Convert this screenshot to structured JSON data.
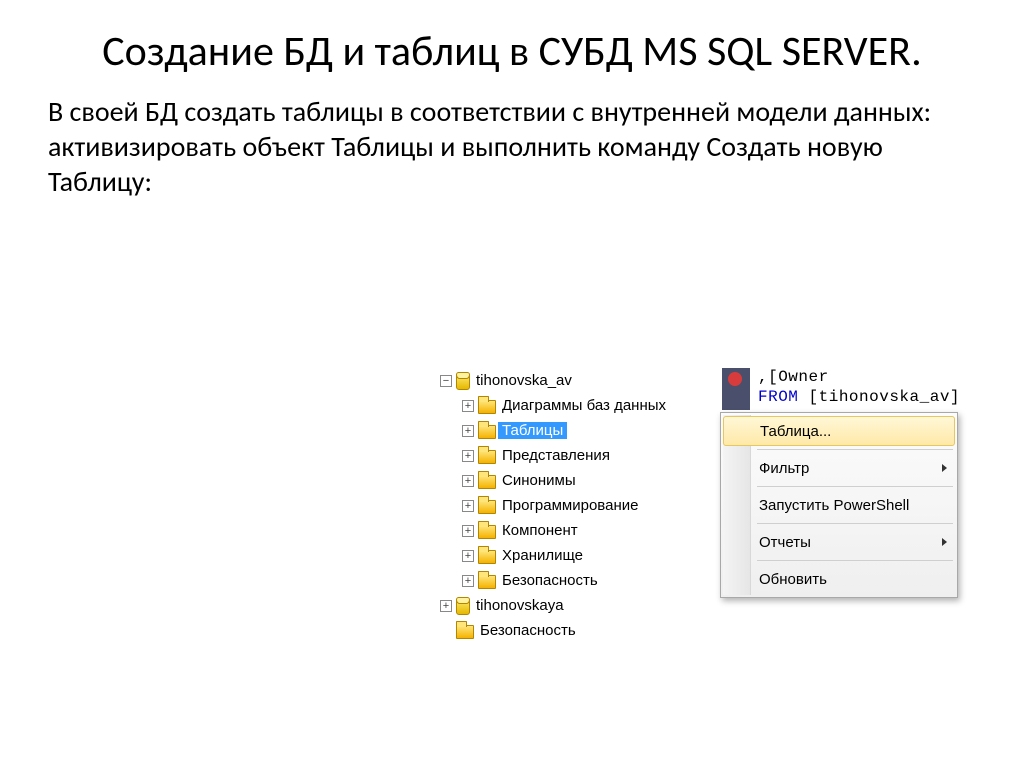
{
  "title": "Создание БД и таблиц в СУБД MS SQL SERVER.",
  "body": "В своей БД создать таблицы в соответствии с внутренней модели данных: активизировать объект Таблицы и выполнить команду Создать новую Таблицу:",
  "tree": {
    "db1": "tihonovska_av",
    "items": [
      "Диаграммы баз данных",
      "Таблицы",
      "Представления",
      "Синонимы",
      "Программирование",
      "Компонент",
      "Хранилище",
      "Безопасность"
    ],
    "db2": "tihonovskaya",
    "security": "Безопасность"
  },
  "code": {
    "line1": ",[Owner",
    "from": "FROM",
    "line2": " [tihonovska_av]"
  },
  "menu": {
    "items": [
      "Таблица...",
      "Фильтр",
      "Запустить PowerShell",
      "Отчеты",
      "Обновить"
    ]
  }
}
